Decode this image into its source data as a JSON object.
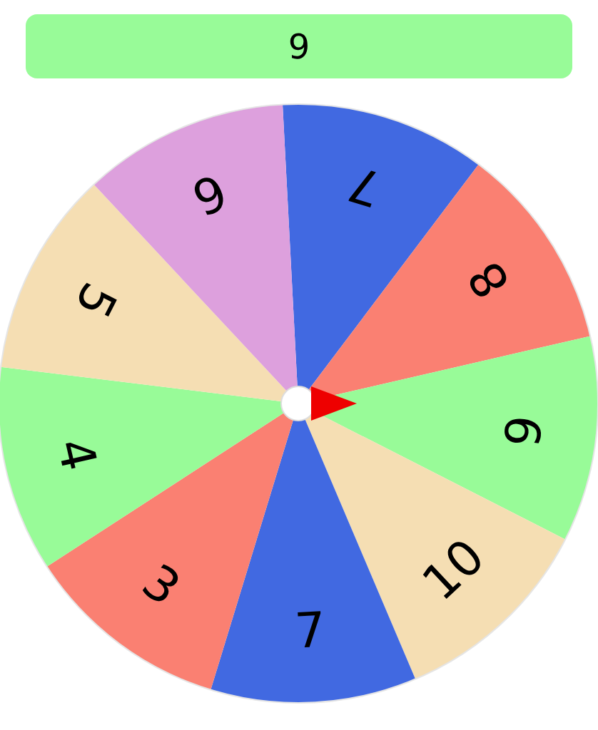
{
  "result": "9",
  "wheel": {
    "segments": [
      {
        "label": "7",
        "color": "#4169e1"
      },
      {
        "label": "8",
        "color": "#fa8072"
      },
      {
        "label": "9",
        "color": "#98fb98"
      },
      {
        "label": "10",
        "color": "#f5deb3"
      },
      {
        "label": "7",
        "color": "#4169e1"
      },
      {
        "label": "3",
        "color": "#fa8072"
      },
      {
        "label": "4",
        "color": "#98fb98"
      },
      {
        "label": "5",
        "color": "#f5deb3"
      },
      {
        "label": "6",
        "color": "#dda0dd"
      }
    ]
  }
}
